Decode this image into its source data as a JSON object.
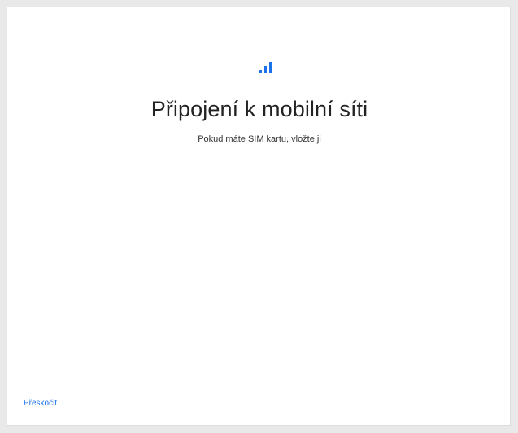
{
  "header": {
    "icon": "signal-bars-icon",
    "title": "Připojení k mobilní síti",
    "subtitle": "Pokud máte SIM kartu, vložte ji"
  },
  "footer": {
    "skip_label": "Přeskočit"
  },
  "colors": {
    "accent": "#1a73e8",
    "background": "#ffffff",
    "outer": "#e9e9e9"
  }
}
